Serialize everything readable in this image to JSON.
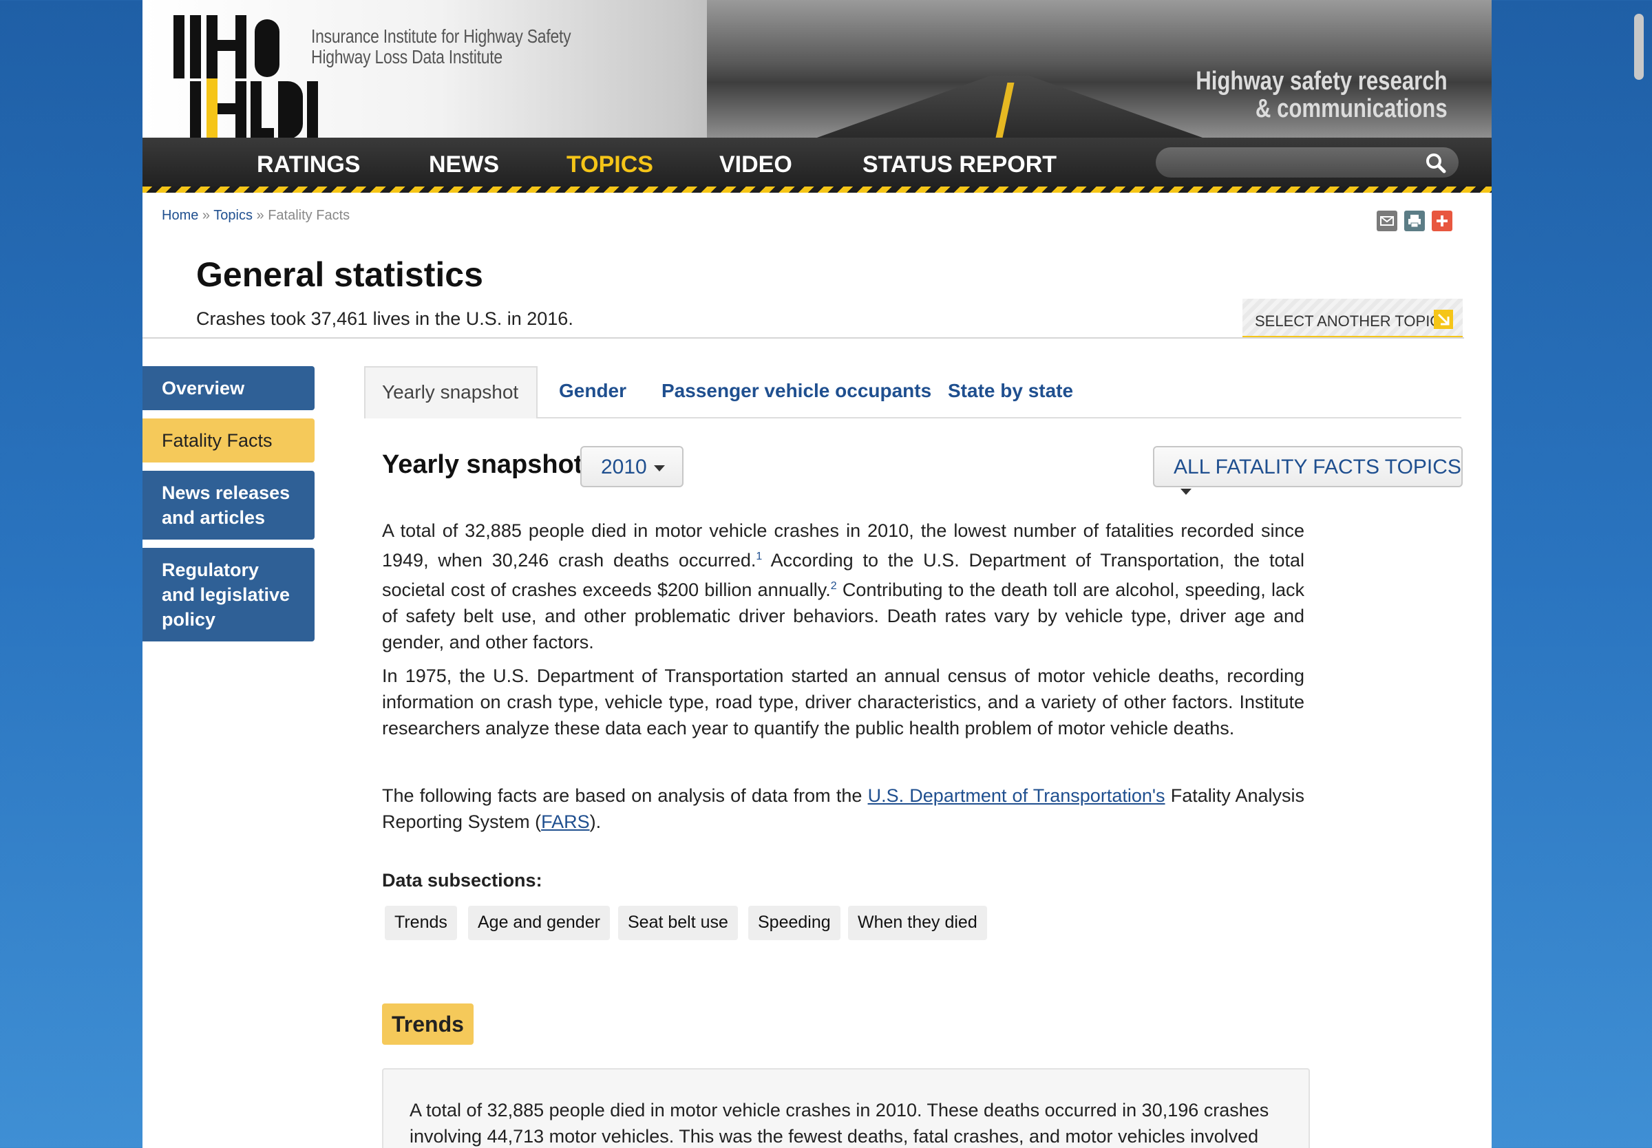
{
  "brand": {
    "logo_line1": "IIHS",
    "logo_line2": "HLDI",
    "org_line1": "Insurance Institute for Highway Safety",
    "org_line2": "Highway Loss Data Institute",
    "tagline_line1": "Highway safety research",
    "tagline_line2": "& communications"
  },
  "nav": {
    "items": [
      "RATINGS",
      "NEWS",
      "TOPICS",
      "VIDEO",
      "STATUS REPORT"
    ],
    "active": "TOPICS",
    "search_icon": "search-icon"
  },
  "breadcrumb": {
    "home": "Home",
    "sep": "»",
    "topics": "Topics",
    "current": "Fatality Facts"
  },
  "tools": [
    "email-icon",
    "print-icon",
    "share-plus-icon"
  ],
  "page": {
    "title": "General statistics",
    "subtitle": "Crashes took 37,461 lives in the U.S. in 2016.",
    "select_topic": "SELECT ANOTHER TOPIC"
  },
  "sidebar": {
    "items": [
      {
        "label": "Overview"
      },
      {
        "label": "Fatality Facts"
      },
      {
        "label": "News releases and articles"
      },
      {
        "label": "Regulatory and legislative policy"
      }
    ]
  },
  "tabs": [
    "Yearly snapshot",
    "Gender",
    "Passenger vehicle occupants",
    "State by state"
  ],
  "snapshot": {
    "title": "Yearly snapshot",
    "year": "2010",
    "all_topics": "ALL FATALITY FACTS TOPICS"
  },
  "paragraphs": {
    "p1_a": "A total of 32,885 people died in motor vehicle crashes in 2010, the lowest number of fatalities recorded since 1949, when 30,246 crash deaths occurred.",
    "p1_sup1": "1",
    "p1_b": " According to the U.S. Department of Transportation, the total societal cost of crashes exceeds $200 billion annually.",
    "p1_sup2": "2",
    "p1_c": " Contributing to the death toll are alcohol, speeding, lack of safety belt use, and other problematic driver behaviors. Death rates vary by vehicle type, driver age and gender, and other factors.",
    "p2": "In 1975, the U.S. Department of Transportation started an annual census of motor vehicle deaths, recording information on crash type, vehicle type, road type, driver characteristics, and a variety of other factors. Institute researchers analyze these data each year to quantify the public health problem of motor vehicle deaths.",
    "p3_a": "The following facts are based on analysis of data from the ",
    "p3_link1": "U.S. Department of Transportation's",
    "p3_b": " Fatality Analysis Reporting System (",
    "p3_link2": "FARS",
    "p3_c": ")."
  },
  "subsections": {
    "label": "Data subsections:",
    "chips": [
      "Trends",
      "Age and gender",
      "Seat belt use",
      "Speeding",
      "When they died"
    ]
  },
  "trends": {
    "heading": "Trends",
    "text": "A total of 32,885 people died in motor vehicle crashes in 2010. These deaths occurred in 30,196 crashes involving 44,713 motor vehicles. This was the fewest deaths, fatal crashes, and motor vehicles involved"
  },
  "colors": {
    "accent_yellow": "#f5c518",
    "sidebar_blue": "#2f6096",
    "link_blue": "#1f4f8f",
    "sidebar_active": "#f5c95a"
  }
}
